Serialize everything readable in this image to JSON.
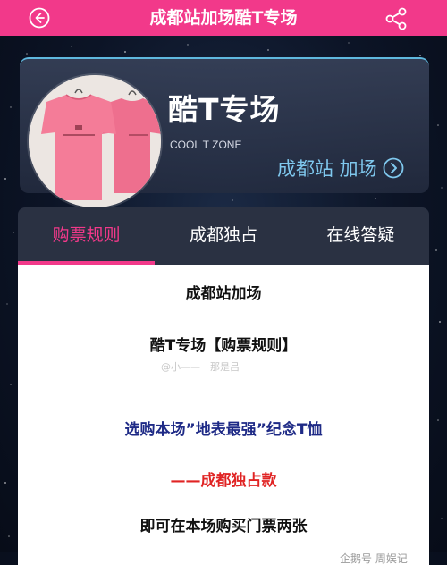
{
  "header": {
    "title": "成都站加场酷T专场",
    "back_icon": "back-arrow-icon",
    "share_icon": "share-icon",
    "background_color": "#f2398a"
  },
  "hero": {
    "title": "酷T专场",
    "subtitle": "COOL T ZONE",
    "link_label": "成都站 加场",
    "link_icon": "chevron-right-circle-icon",
    "image": "pink-tshirts-thumbnail"
  },
  "tabs": [
    {
      "label": "购票规则",
      "active": true
    },
    {
      "label": "成都独占",
      "active": false
    },
    {
      "label": "在线答疑",
      "active": false
    }
  ],
  "content": {
    "line1": "成都站加场",
    "line2": "酷T专场【购票规则】",
    "line3": "选购本场”地表最强”纪念T恤",
    "line4": "——成都独占款",
    "line5": "即可在本场购买门票两张",
    "watermark": "@小—— 那是吕",
    "watermark2": "企鹅号 周娱记"
  },
  "colors": {
    "accent": "#f2398a",
    "link": "#7fc8ee",
    "navy_text": "#1e2a86",
    "red_text": "#e02424"
  }
}
